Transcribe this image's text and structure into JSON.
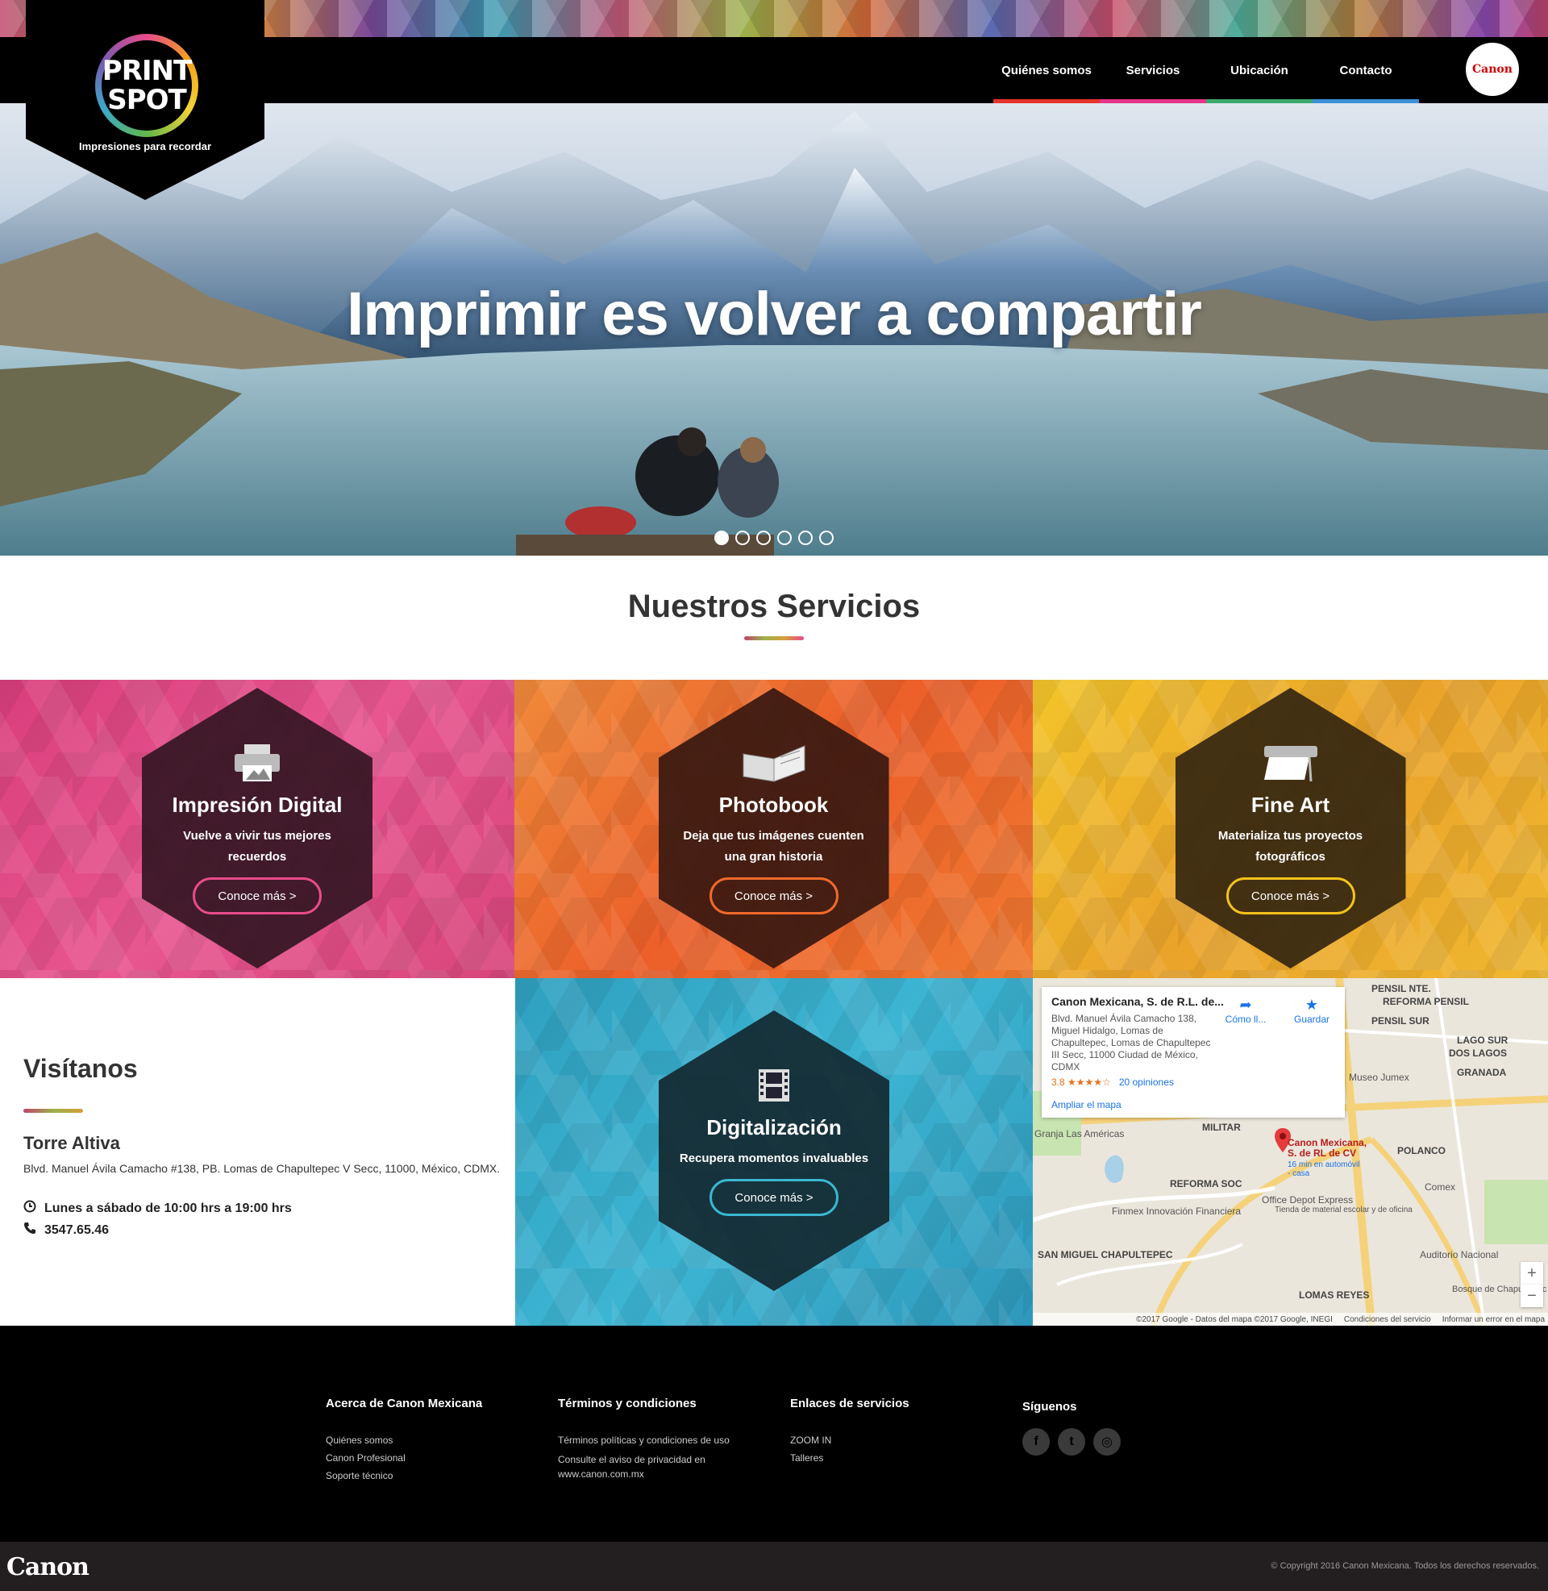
{
  "brand": {
    "logo_line1": "PRINT",
    "logo_line2": "SPOT",
    "tagline": "Impresiones para recordar",
    "canon_badge": "Canon"
  },
  "nav": {
    "items": [
      {
        "label": "Quiénes somos",
        "color": "#e6332a"
      },
      {
        "label": "Servicios",
        "color": "#e6338a"
      },
      {
        "label": "Ubicación",
        "color": "#3aa86b"
      },
      {
        "label": "Contacto",
        "color": "#3a8fd6"
      }
    ]
  },
  "hero": {
    "title": "Imprimir es volver a compartir",
    "slides": 6,
    "active_slide": 1
  },
  "services": {
    "heading": "Nuestros Servicios",
    "items": [
      {
        "title": "Impresión Digital",
        "desc": "Vuelve a vivir tus mejores recuerdos",
        "button": "Conoce más >",
        "icon": "printer-icon",
        "accent": "#e84c8a",
        "bg": "#e0457f"
      },
      {
        "title": "Photobook",
        "desc": "Deja que tus imágenes cuenten una gran historia",
        "button": "Conoce más >",
        "icon": "book-icon",
        "accent": "#f06a2a",
        "bg": "#ee6b2f"
      },
      {
        "title": "Fine Art",
        "desc": "Materializa tus proyectos fotográficos",
        "button": "Conoce más >",
        "icon": "large-printer-icon",
        "accent": "#f5c21a",
        "bg": "#f0b22a"
      },
      {
        "title": "Digitalización",
        "desc": "Recupera momentos invaluables",
        "button": "Conoce más >",
        "icon": "film-icon",
        "accent": "#3ab8d0",
        "bg": "#35aac8"
      }
    ]
  },
  "visit": {
    "heading": "Visítanos",
    "place": "Torre Altiva",
    "address": "Blvd. Manuel Ávila Camacho #138, PB. Lomas de Chapultepec V Secc, 11000, México, CDMX.",
    "hours": "Lunes a sábado de 10:00 hrs a 19:00 hrs",
    "phone": "3547.65.46"
  },
  "map": {
    "card_title": "Canon Mexicana, S. de R.L. de...",
    "card_address": "Blvd. Manuel Ávila Camacho 138, Miguel Hidalgo, Lomas de Chapultepec, Lomas de Chapultepec III Secc, 11000 Ciudad de México, CDMX",
    "rating": "3.8 ★★★★☆",
    "reviews": "20 opiniones",
    "expand": "Ampliar el mapa",
    "directions": "Cómo ll...",
    "save": "Guardar",
    "pin_label": "Canon Mexicana, S. de RL de CV",
    "pin_sub": "16 min en automóvil - casa",
    "labels": {
      "pensil_nte": "PENSIL NTE.",
      "reforma_pensil": "REFORMA PENSIL",
      "pensil_sur": "PENSIL SUR",
      "lago_sur": "LAGO SUR",
      "dos_lagos": "DOS LAGOS",
      "granada": "GRANADA",
      "museo_jumex": "Museo Jumex",
      "militar": "MILITAR",
      "granja": "Granja Las Américas",
      "polanco": "POLANCO",
      "reforma_soc": "REFORMA SOC",
      "comex": "Comex",
      "finmex": "Finmex Innovación Financiera",
      "office_depot": "Office Depot Express",
      "office_depot_sub": "Tienda de material escolar y de oficina",
      "san_miguel": "SAN MIGUEL CHAPULTEPEC",
      "auditorio": "Auditorio Nacional",
      "lomas_reyes": "LOMAS REYES",
      "bosque": "Bosque de Chapultepec"
    },
    "footer": [
      "©2017 Google - Datos del mapa ©2017 Google, INEGI",
      "Condiciones del servicio",
      "Informar un error en el mapa"
    ],
    "zoom_in": "+",
    "zoom_out": "−"
  },
  "footer": {
    "columns": [
      {
        "heading": "Acerca de Canon Mexicana",
        "links": [
          "Quiénes somos",
          "Canon Profesional",
          "Soporte técnico"
        ]
      },
      {
        "heading": "Términos y condiciones",
        "links": [
          "Términos políticas y condiciones de uso",
          "Consulte el aviso de privacidad en www.canon.com.mx"
        ]
      },
      {
        "heading": "Enlaces de servicios",
        "links": [
          "ZOOM IN",
          "Talleres"
        ]
      },
      {
        "heading": "Síguenos",
        "links": []
      }
    ],
    "social": [
      {
        "name": "facebook-icon",
        "glyph": "f"
      },
      {
        "name": "twitter-icon",
        "glyph": "t"
      },
      {
        "name": "instagram-icon",
        "glyph": "◎"
      }
    ],
    "bottom_logo": "Canon",
    "copyright": "© Copyright 2016 Canon Mexicana. Todos los derechos reservados."
  }
}
